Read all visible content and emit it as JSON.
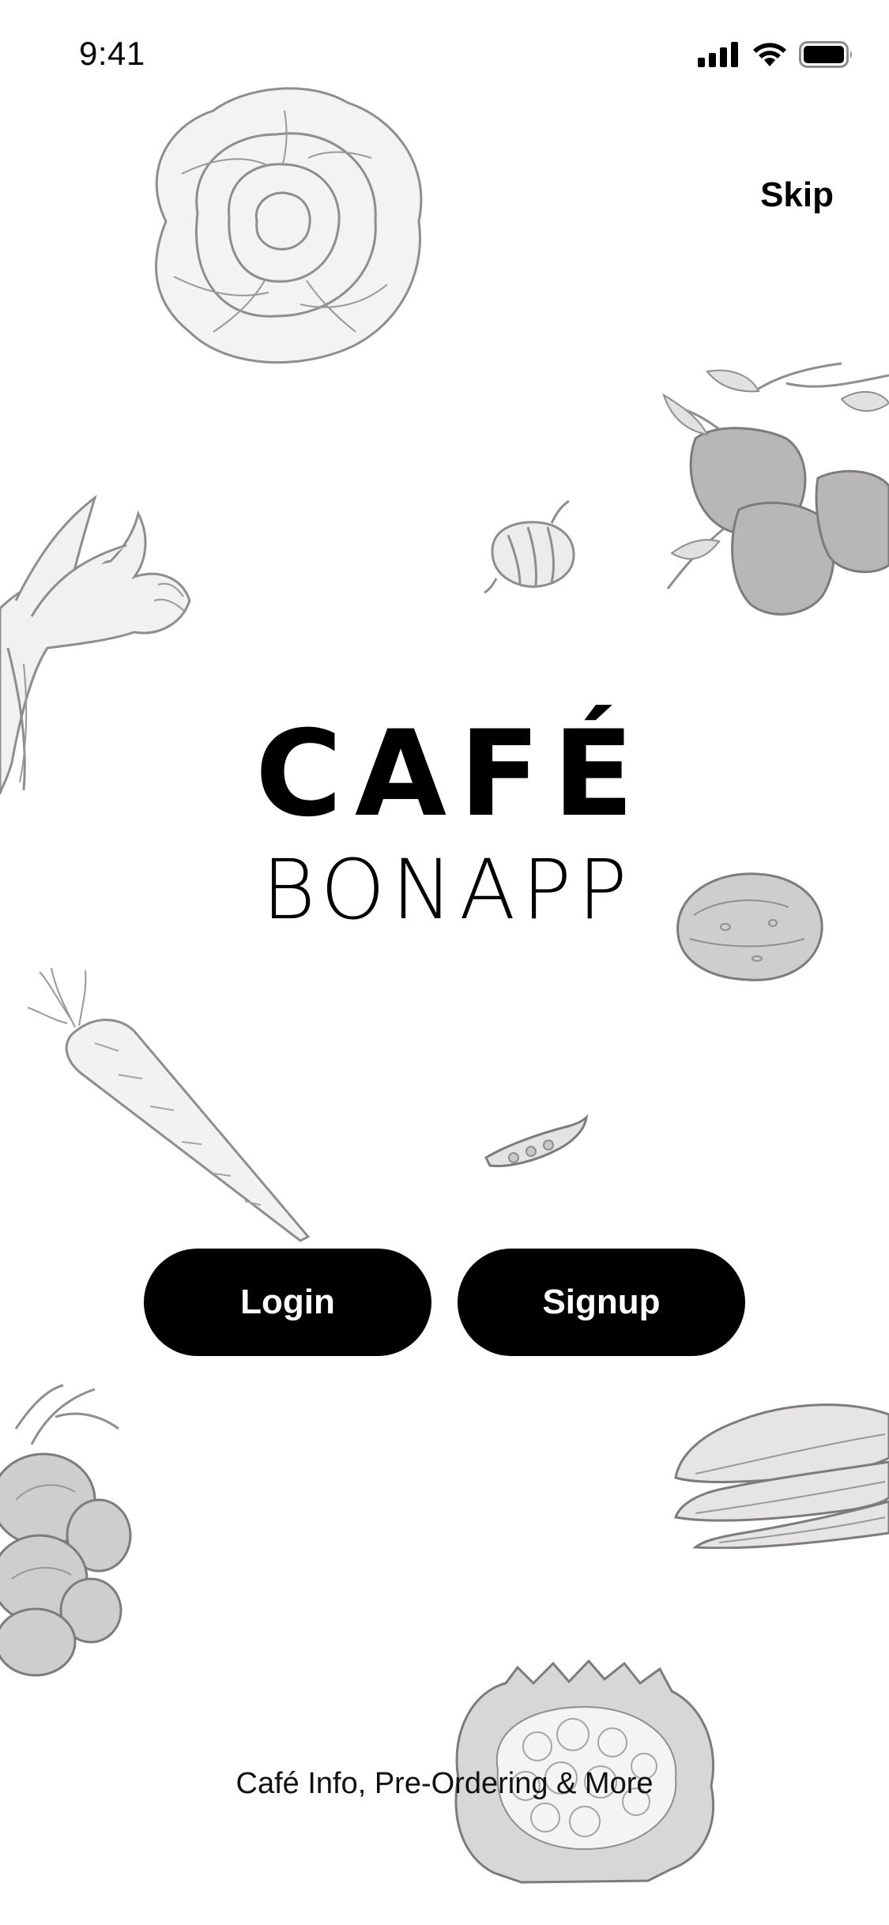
{
  "status_bar": {
    "time": "9:41",
    "icons": [
      "cellular-signal-icon",
      "wifi-icon",
      "battery-icon"
    ]
  },
  "header": {
    "skip_label": "Skip"
  },
  "logo": {
    "line1": "CAFÉ",
    "line2": "BONAPP"
  },
  "actions": {
    "login_label": "Login",
    "signup_label": "Signup"
  },
  "footer": {
    "tagline": "Café Info, Pre-Ordering & More"
  },
  "illustrations": [
    "lettuce",
    "bell-peppers",
    "onion",
    "leek",
    "potato",
    "carrot",
    "pea-pod",
    "tomatoes",
    "bok-choy",
    "cauliflower"
  ],
  "colors": {
    "background": "#ffffff",
    "button": "#000000",
    "button_text": "#ffffff",
    "illustration": "#9a9898"
  }
}
